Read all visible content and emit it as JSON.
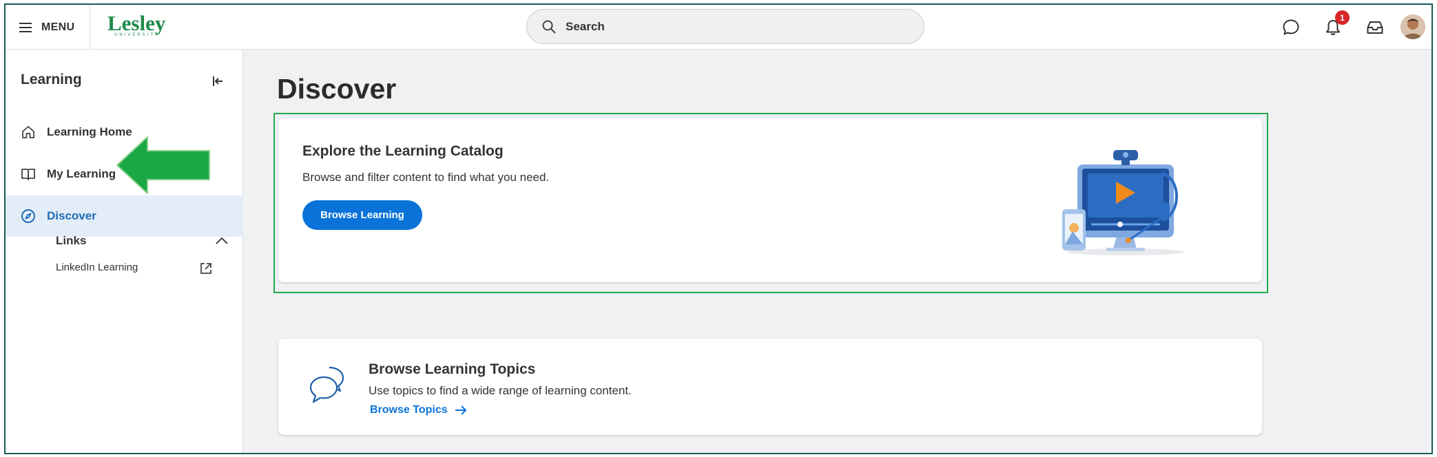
{
  "topbar": {
    "menu_label": "MENU",
    "logo_text": "Lesley",
    "logo_subtext": "UNIVERSITY",
    "search_placeholder": "Search",
    "notification_count": "1"
  },
  "sidebar": {
    "title": "Learning",
    "items": [
      {
        "label": "Learning Home",
        "icon": "home-icon"
      },
      {
        "label": "My Learning",
        "icon": "book-icon"
      },
      {
        "label": "Discover",
        "icon": "compass-icon",
        "active": true
      }
    ],
    "links_heading": "Links",
    "links": [
      {
        "label": "LinkedIn Learning",
        "icon": "external-link-icon"
      }
    ]
  },
  "main": {
    "title": "Discover",
    "catalog_card": {
      "heading": "Explore the Learning Catalog",
      "description": "Browse and filter content to find what you need.",
      "button_label": "Browse Learning"
    },
    "topics_card": {
      "heading": "Browse Learning Topics",
      "description": "Use topics to find a wide range of learning content.",
      "link_label": "Browse Topics"
    }
  },
  "colors": {
    "accent": "#0a73d9",
    "active_nav_bg": "#e3edf8",
    "highlight_border": "#1faa4a",
    "annotation_arrow": "#1aa845",
    "badge": "#d72626",
    "logo": "#1e8a4a"
  }
}
